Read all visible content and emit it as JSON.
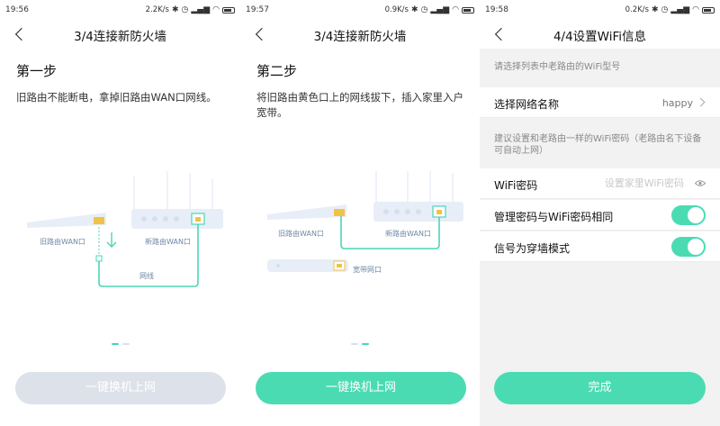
{
  "colors": {
    "accent": "#4bdbb3",
    "disabled": "#dde1ea",
    "illustration_line": "#4bd5b5",
    "router_body": "#e8eef8",
    "port": "#f0c247"
  },
  "screens": [
    {
      "status": {
        "time": "19:56",
        "speed": "2.2K/s"
      },
      "title": "3/4连接新防火墙",
      "step_title": "第一步",
      "step_desc": "旧路由不能断电，拿掉旧路由WAN口网线。",
      "labels": {
        "old_wan": "旧路由WAN口",
        "new_wan": "新路由WAN口",
        "cable": "网线"
      },
      "button": "一键换机上网",
      "button_state": "disabled",
      "page_dots": {
        "count": 2,
        "active": 1
      }
    },
    {
      "status": {
        "time": "19:57",
        "speed": "0.9K/s"
      },
      "title": "3/4连接新防火墙",
      "step_title": "第二步",
      "step_desc": "将旧路由黄色口上的网线拔下，插入家里入户宽带。",
      "labels": {
        "old_wan": "旧路由WAN口",
        "new_wan": "新路由WAN口",
        "broadband": "宽带网口"
      },
      "button": "一键换机上网",
      "button_state": "enabled",
      "page_dots": {
        "count": 2,
        "active": 2
      }
    },
    {
      "status": {
        "time": "19:58",
        "speed": "0.2K/s"
      },
      "title": "4/4设置WiFi信息",
      "hint1": "请选择列表中老路由的WiFi型号",
      "network_label": "选择网络名称",
      "network_value": "happy",
      "hint2": "建议设置和老路由一样的WiFi密码（老路由名下设备可自动上网）",
      "password_label": "WiFi密码",
      "password_placeholder": "设置家里WiFi密码",
      "toggle1_label": "管理密码与WiFi密码相同",
      "toggle1_on": true,
      "toggle2_label": "信号为穿墙模式",
      "toggle2_on": true,
      "button": "完成"
    }
  ],
  "icons": [
    "back-arrow-icon",
    "bluetooth-icon",
    "alarm-icon",
    "signal-icon",
    "wifi-icon",
    "battery-icon",
    "chevron-right-icon",
    "eye-icon",
    "down-arrow-icon"
  ]
}
